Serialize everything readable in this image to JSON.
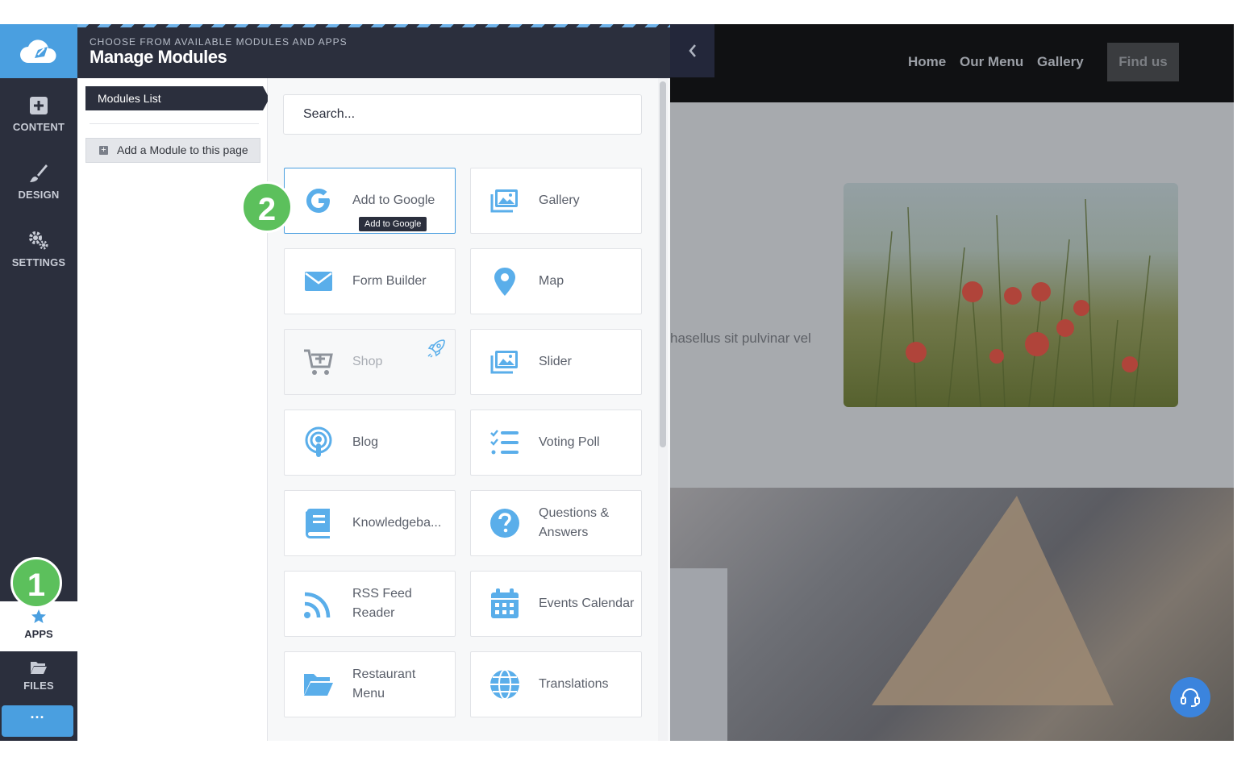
{
  "nav": {
    "content": "CONTENT",
    "design": "DESIGN",
    "settings": "SETTINGS",
    "apps": "APPS",
    "files": "FILES",
    "more": "···"
  },
  "badges": {
    "one": "1",
    "two": "2"
  },
  "panel": {
    "subtitle": "CHOOSE FROM AVAILABLE MODULES AND APPS",
    "title": "Manage Modules",
    "modules_list_tab": "Modules List",
    "add_module": "Add a Module to this page",
    "search_placeholder": "Search..."
  },
  "modules": [
    {
      "label": "Add to Google",
      "icon": "google-icon",
      "state": "active"
    },
    {
      "label": "Gallery",
      "icon": "gallery-icon"
    },
    {
      "label": "Form Builder",
      "icon": "envelope-icon"
    },
    {
      "label": "Map",
      "icon": "map-pin-icon"
    },
    {
      "label": "Shop",
      "icon": "cart-icon",
      "state": "disabled"
    },
    {
      "label": "Slider",
      "icon": "slider-icon"
    },
    {
      "label": "Blog",
      "icon": "podcast-icon"
    },
    {
      "label": "Voting Poll",
      "icon": "checklist-icon"
    },
    {
      "label": "Knowledgeba...",
      "icon": "book-icon"
    },
    {
      "label": "Questions & Answers",
      "icon": "question-icon"
    },
    {
      "label": "RSS Feed Reader",
      "icon": "rss-icon"
    },
    {
      "label": "Events Calendar",
      "icon": "calendar-icon"
    },
    {
      "label": "Restaurant Menu",
      "icon": "folder-icon"
    },
    {
      "label": "Translations",
      "icon": "globe-icon"
    }
  ],
  "tooltip": "Add to Google",
  "site": {
    "nav": [
      "Home",
      "Our Menu",
      "Gallery"
    ],
    "cta": "Find us",
    "body_text": "hasellus sit pulvinar vel"
  },
  "colors": {
    "accent": "#4a9fe0",
    "dark": "#2b2f3d",
    "badge": "#5cc05c"
  }
}
